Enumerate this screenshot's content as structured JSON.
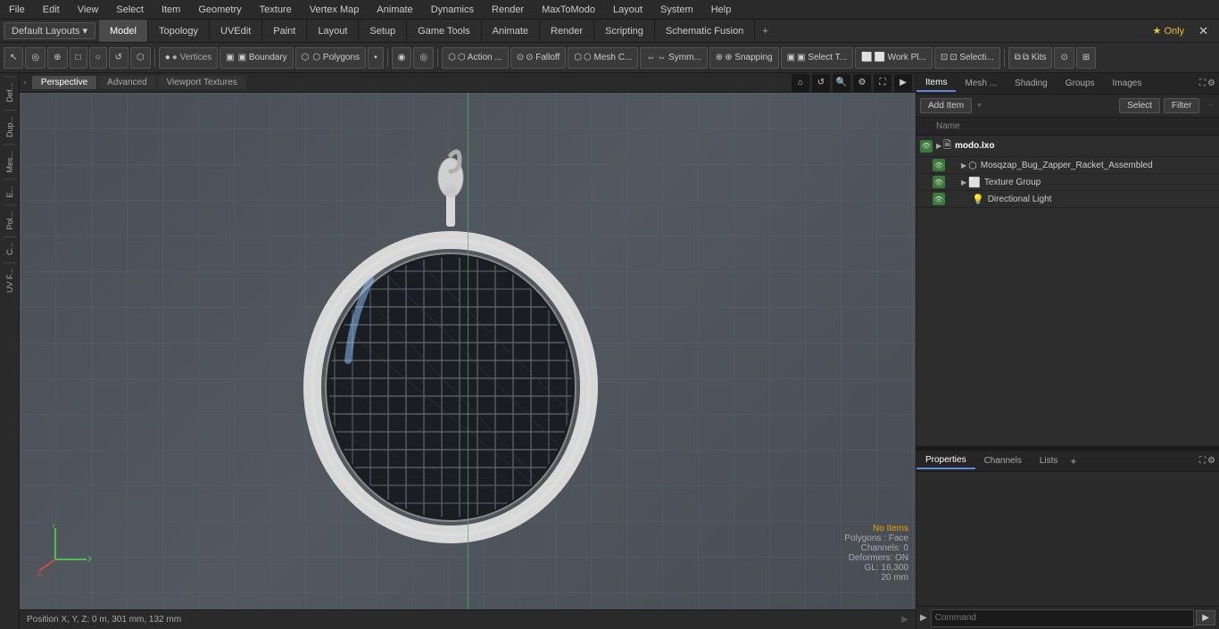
{
  "menubar": {
    "items": [
      "File",
      "Edit",
      "View",
      "Select",
      "Item",
      "Geometry",
      "Texture",
      "Vertex Map",
      "Animate",
      "Dynamics",
      "Render",
      "MaxToModo",
      "Layout",
      "System",
      "Help"
    ]
  },
  "layout": {
    "dropdown_label": "Default Layouts ▾"
  },
  "tabs": {
    "items": [
      "Model",
      "Topology",
      "UVEdit",
      "Paint",
      "Layout",
      "Setup",
      "Game Tools",
      "Animate",
      "Render",
      "Scripting",
      "Schematic Fusion"
    ],
    "active": "Model",
    "plus": "+",
    "star_label": "★ Only",
    "close_label": "✕"
  },
  "toolbar": {
    "tools": [
      {
        "id": "t1",
        "icon": "⬛",
        "label": ""
      },
      {
        "id": "t2",
        "icon": "◉",
        "label": ""
      },
      {
        "id": "t3",
        "icon": "⌂",
        "label": ""
      },
      {
        "id": "t4",
        "icon": "□",
        "label": ""
      },
      {
        "id": "t5",
        "icon": "◌",
        "label": ""
      },
      {
        "id": "t6",
        "icon": "⟳",
        "label": ""
      },
      {
        "id": "t7",
        "icon": "⬡",
        "label": ""
      }
    ],
    "vertices_btn": "● Vertices",
    "boundary_btn": "▣ Boundary",
    "polygons_btn": "⬡ Polygons",
    "paint_btn": "▪",
    "toggle1": "◉",
    "toggle2": "◎",
    "action_btn": "⬡ Action ...",
    "falloff_btn": "⊙ Falloff",
    "mesh_btn": "⬡ Mesh C...",
    "symm_btn": "⇔ Symm...",
    "snapping_btn": "⊕ Snapping",
    "select_t_btn": "▣ Select T...",
    "work_pl_btn": "⬜ Work Pl...",
    "selecti_btn": "⊡ Selecti...",
    "kits_btn": "⧉ Kits",
    "cam_btn": "⊙",
    "view_btn": "⊞"
  },
  "viewport": {
    "tabs": [
      "Perspective",
      "Advanced",
      "Viewport Textures"
    ],
    "active_tab": "Perspective",
    "status": {
      "no_items": "No Items",
      "polygons": "Polygons : Face",
      "channels": "Channels: 0",
      "deformers": "Deformers: ON",
      "gl": "GL: 16,300",
      "units": "20 mm"
    },
    "position_label": "Position X, Y, Z:  0 m, 301 mm, 132 mm"
  },
  "items_panel": {
    "tabs": [
      "Items",
      "Mesh ...",
      "Shading",
      "Groups",
      "Images"
    ],
    "active_tab": "Items",
    "add_item_label": "Add Item",
    "select_label": "Select",
    "filter_label": "Filter",
    "name_header": "Name",
    "items": [
      {
        "id": "i1",
        "indent": 0,
        "arrow": "▶",
        "icon": "🗎",
        "name": "modo.lxo",
        "bold": true,
        "visible": true
      },
      {
        "id": "i2",
        "indent": 1,
        "arrow": "▶",
        "icon": "⬡",
        "name": "Mosqzap_Bug_Zapper_Racket_Assembled",
        "bold": false,
        "visible": true
      },
      {
        "id": "i3",
        "indent": 1,
        "arrow": "▶",
        "icon": "⬜",
        "name": "Texture Group",
        "bold": false,
        "visible": true
      },
      {
        "id": "i4",
        "indent": 1,
        "arrow": "",
        "icon": "💡",
        "name": "Directional Light",
        "bold": false,
        "visible": true
      }
    ]
  },
  "properties_panel": {
    "tabs": [
      "Properties",
      "Channels",
      "Lists"
    ],
    "active_tab": "Properties",
    "plus_label": "+"
  },
  "command_bar": {
    "placeholder": "Command",
    "submit_label": "▶"
  },
  "left_sidebar": {
    "tabs": [
      "Def...",
      "Dup...",
      "Mes...",
      "E...",
      "Pol...",
      "C...",
      "UV F..."
    ]
  }
}
